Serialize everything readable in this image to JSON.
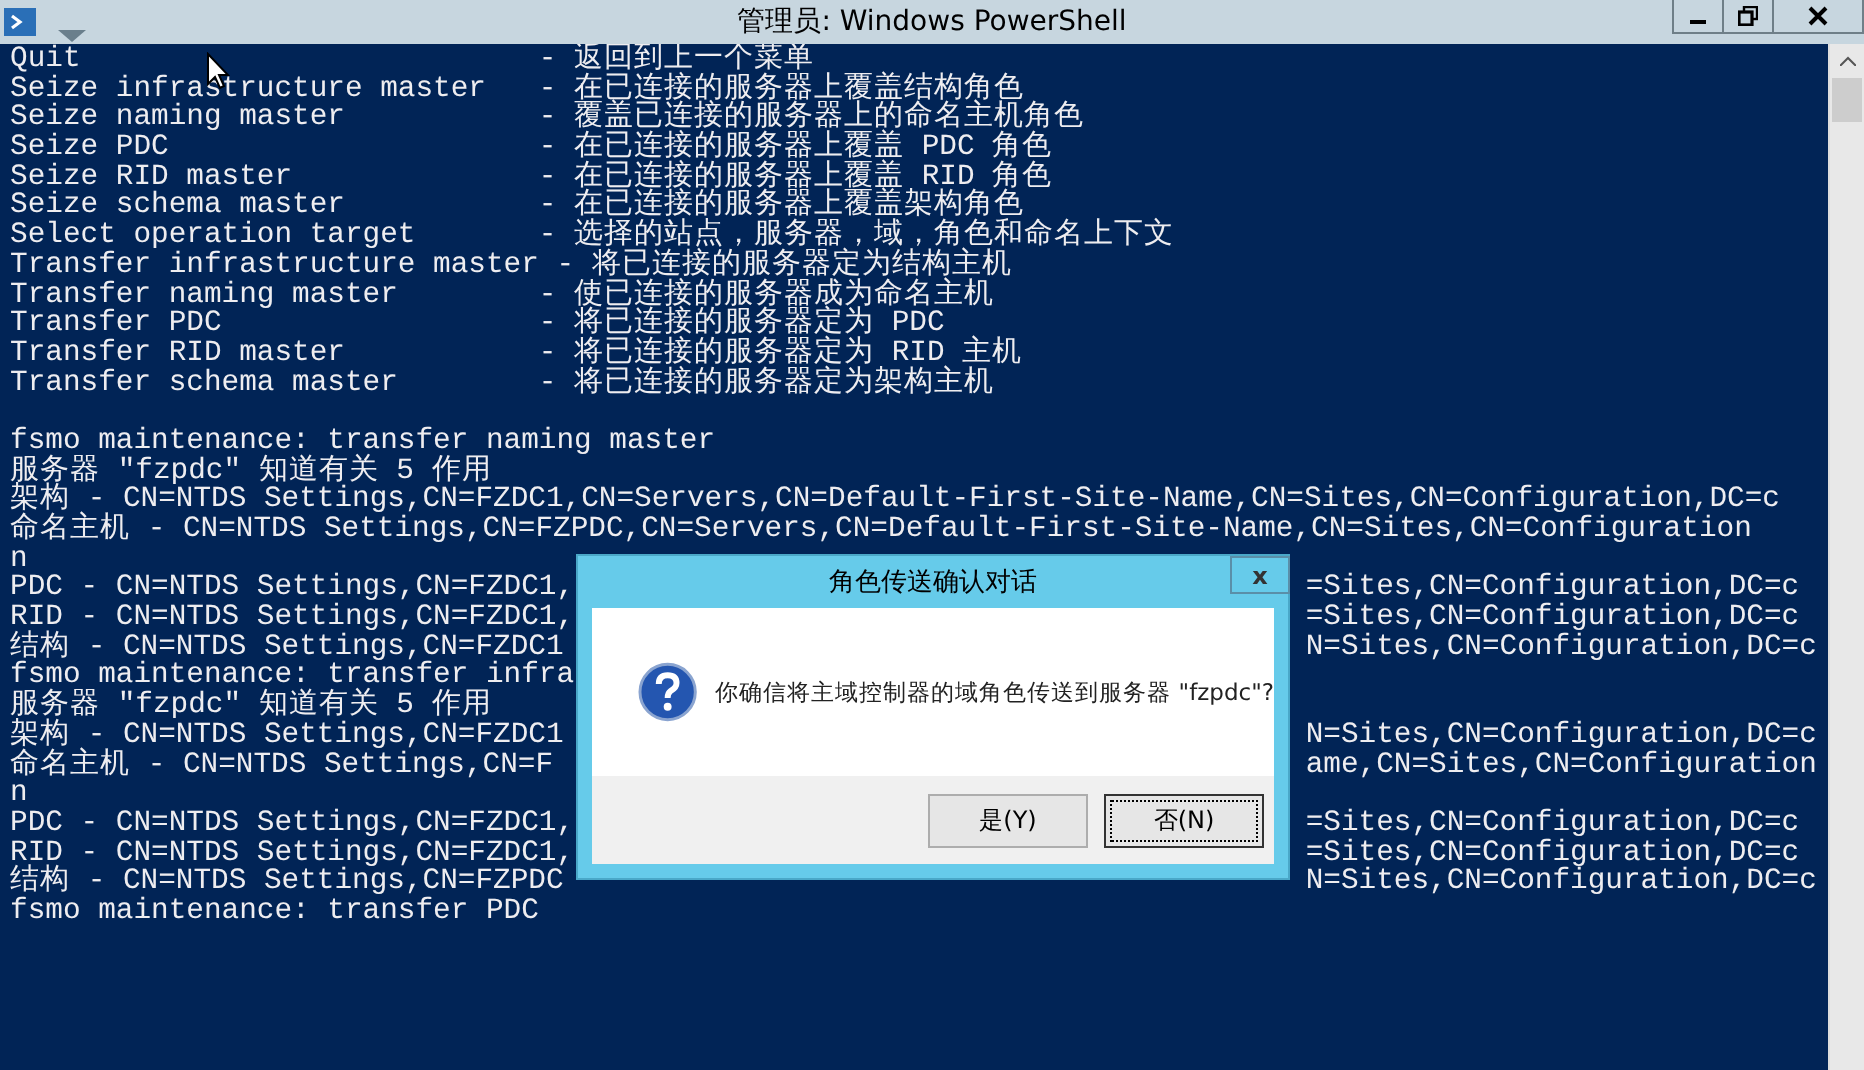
{
  "window": {
    "title": "管理员: Windows PowerShell"
  },
  "console": {
    "lines": [
      {
        "kind": "menu",
        "command": "Quit",
        "description": "- 返回到上一个菜单"
      },
      {
        "kind": "menu",
        "command": "Seize infrastructure master",
        "description": "- 在已连接的服务器上覆盖结构角色"
      },
      {
        "kind": "menu",
        "command": "Seize naming master",
        "description": "- 覆盖已连接的服务器上的命名主机角色"
      },
      {
        "kind": "menu",
        "command": "Seize PDC",
        "description": "- 在已连接的服务器上覆盖 PDC 角色"
      },
      {
        "kind": "menu",
        "command": "Seize RID master",
        "description": "- 在已连接的服务器上覆盖 RID 角色"
      },
      {
        "kind": "menu",
        "command": "Seize schema master",
        "description": "- 在已连接的服务器上覆盖架构角色"
      },
      {
        "kind": "menu",
        "command": "Select operation target",
        "description": "- 选择的站点，服务器，域，角色和命名上下文"
      },
      {
        "kind": "menu",
        "command": "Transfer infrastructure master",
        "description": "- 将已连接的服务器定为结构主机"
      },
      {
        "kind": "menu",
        "command": "Transfer naming master",
        "description": "- 使已连接的服务器成为命名主机"
      },
      {
        "kind": "menu",
        "command": "Transfer PDC",
        "description": "- 将已连接的服务器定为 PDC"
      },
      {
        "kind": "menu",
        "command": "Transfer RID master",
        "description": "- 将已连接的服务器定为 RID 主机"
      },
      {
        "kind": "menu",
        "command": "Transfer schema master",
        "description": "- 将已连接的服务器定为架构主机"
      },
      {
        "kind": "blank"
      },
      {
        "kind": "line",
        "text": "fsmo maintenance: transfer naming master"
      },
      {
        "kind": "line",
        "text": "服务器 \"fzpdc\" 知道有关 5 作用"
      },
      {
        "kind": "line",
        "text": "架构 - CN=NTDS Settings,CN=FZDC1,CN=Servers,CN=Default-First-Site-Name,CN=Sites,CN=Configuration,DC=c"
      },
      {
        "kind": "line",
        "text": "命名主机 - CN=NTDS Settings,CN=FZPDC,CN=Servers,CN=Default-First-Site-Name,CN=Sites,CN=Configuration"
      },
      {
        "kind": "line",
        "text": "n"
      },
      {
        "kind": "split",
        "text": "PDC - CN=NTDS Settings,CN=FZDC1,",
        "right": "=Sites,CN=Configuration,DC=c"
      },
      {
        "kind": "split",
        "text": "RID - CN=NTDS Settings,CN=FZDC1,",
        "right": "=Sites,CN=Configuration,DC=c"
      },
      {
        "kind": "split",
        "text": "结构 - CN=NTDS Settings,CN=FZDC1",
        "right": "N=Sites,CN=Configuration,DC=c"
      },
      {
        "kind": "split",
        "text": "fsmo maintenance: transfer infra"
      },
      {
        "kind": "split",
        "text": "服务器 \"fzpdc\" 知道有关 5 作用"
      },
      {
        "kind": "split",
        "text": "架构 - CN=NTDS Settings,CN=FZDC1",
        "right": "N=Sites,CN=Configuration,DC=c"
      },
      {
        "kind": "split",
        "text": "命名主机 - CN=NTDS Settings,CN=F",
        "right": "ame,CN=Sites,CN=Configuration"
      },
      {
        "kind": "line",
        "text": "n"
      },
      {
        "kind": "split",
        "text": "PDC - CN=NTDS Settings,CN=FZDC1,",
        "right": "=Sites,CN=Configuration,DC=c"
      },
      {
        "kind": "split",
        "text": "RID - CN=NTDS Settings,CN=FZDC1,",
        "right": "=Sites,CN=Configuration,DC=c"
      },
      {
        "kind": "split",
        "text": "结构 - CN=NTDS Settings,CN=FZPDC",
        "right": "N=Sites,CN=Configuration,DC=c"
      },
      {
        "kind": "line",
        "text": "fsmo maintenance: transfer PDC"
      }
    ]
  },
  "dialog": {
    "title": "角色传送确认对话",
    "close": "x",
    "message": "你确信将主域控制器的域角色传送到服务器 \"fzpdc\"?",
    "buttons": [
      {
        "label": "是(Y)",
        "selected": false
      },
      {
        "label": "否(N)",
        "selected": true
      }
    ]
  }
}
